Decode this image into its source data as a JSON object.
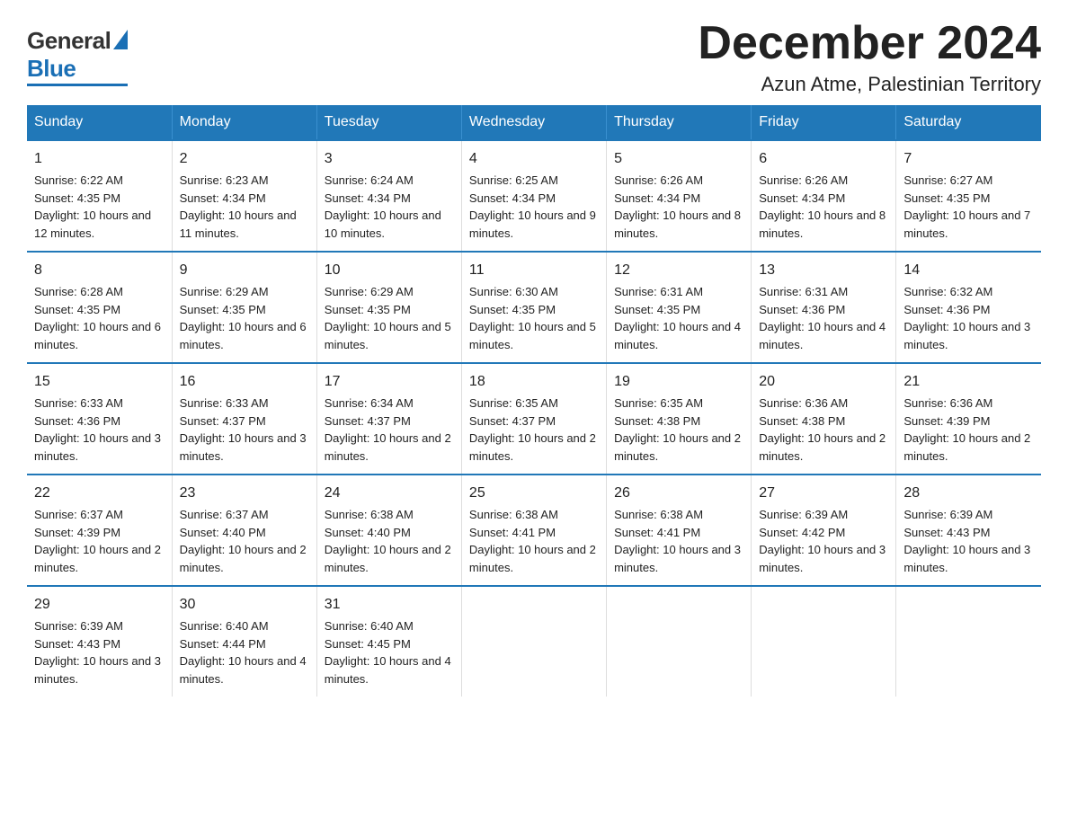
{
  "logo": {
    "general": "General",
    "blue": "Blue"
  },
  "title": "December 2024",
  "subtitle": "Azun Atme, Palestinian Territory",
  "days_of_week": [
    "Sunday",
    "Monday",
    "Tuesday",
    "Wednesday",
    "Thursday",
    "Friday",
    "Saturday"
  ],
  "weeks": [
    [
      {
        "day": "1",
        "sunrise": "Sunrise: 6:22 AM",
        "sunset": "Sunset: 4:35 PM",
        "daylight": "Daylight: 10 hours and 12 minutes."
      },
      {
        "day": "2",
        "sunrise": "Sunrise: 6:23 AM",
        "sunset": "Sunset: 4:34 PM",
        "daylight": "Daylight: 10 hours and 11 minutes."
      },
      {
        "day": "3",
        "sunrise": "Sunrise: 6:24 AM",
        "sunset": "Sunset: 4:34 PM",
        "daylight": "Daylight: 10 hours and 10 minutes."
      },
      {
        "day": "4",
        "sunrise": "Sunrise: 6:25 AM",
        "sunset": "Sunset: 4:34 PM",
        "daylight": "Daylight: 10 hours and 9 minutes."
      },
      {
        "day": "5",
        "sunrise": "Sunrise: 6:26 AM",
        "sunset": "Sunset: 4:34 PM",
        "daylight": "Daylight: 10 hours and 8 minutes."
      },
      {
        "day": "6",
        "sunrise": "Sunrise: 6:26 AM",
        "sunset": "Sunset: 4:34 PM",
        "daylight": "Daylight: 10 hours and 8 minutes."
      },
      {
        "day": "7",
        "sunrise": "Sunrise: 6:27 AM",
        "sunset": "Sunset: 4:35 PM",
        "daylight": "Daylight: 10 hours and 7 minutes."
      }
    ],
    [
      {
        "day": "8",
        "sunrise": "Sunrise: 6:28 AM",
        "sunset": "Sunset: 4:35 PM",
        "daylight": "Daylight: 10 hours and 6 minutes."
      },
      {
        "day": "9",
        "sunrise": "Sunrise: 6:29 AM",
        "sunset": "Sunset: 4:35 PM",
        "daylight": "Daylight: 10 hours and 6 minutes."
      },
      {
        "day": "10",
        "sunrise": "Sunrise: 6:29 AM",
        "sunset": "Sunset: 4:35 PM",
        "daylight": "Daylight: 10 hours and 5 minutes."
      },
      {
        "day": "11",
        "sunrise": "Sunrise: 6:30 AM",
        "sunset": "Sunset: 4:35 PM",
        "daylight": "Daylight: 10 hours and 5 minutes."
      },
      {
        "day": "12",
        "sunrise": "Sunrise: 6:31 AM",
        "sunset": "Sunset: 4:35 PM",
        "daylight": "Daylight: 10 hours and 4 minutes."
      },
      {
        "day": "13",
        "sunrise": "Sunrise: 6:31 AM",
        "sunset": "Sunset: 4:36 PM",
        "daylight": "Daylight: 10 hours and 4 minutes."
      },
      {
        "day": "14",
        "sunrise": "Sunrise: 6:32 AM",
        "sunset": "Sunset: 4:36 PM",
        "daylight": "Daylight: 10 hours and 3 minutes."
      }
    ],
    [
      {
        "day": "15",
        "sunrise": "Sunrise: 6:33 AM",
        "sunset": "Sunset: 4:36 PM",
        "daylight": "Daylight: 10 hours and 3 minutes."
      },
      {
        "day": "16",
        "sunrise": "Sunrise: 6:33 AM",
        "sunset": "Sunset: 4:37 PM",
        "daylight": "Daylight: 10 hours and 3 minutes."
      },
      {
        "day": "17",
        "sunrise": "Sunrise: 6:34 AM",
        "sunset": "Sunset: 4:37 PM",
        "daylight": "Daylight: 10 hours and 2 minutes."
      },
      {
        "day": "18",
        "sunrise": "Sunrise: 6:35 AM",
        "sunset": "Sunset: 4:37 PM",
        "daylight": "Daylight: 10 hours and 2 minutes."
      },
      {
        "day": "19",
        "sunrise": "Sunrise: 6:35 AM",
        "sunset": "Sunset: 4:38 PM",
        "daylight": "Daylight: 10 hours and 2 minutes."
      },
      {
        "day": "20",
        "sunrise": "Sunrise: 6:36 AM",
        "sunset": "Sunset: 4:38 PM",
        "daylight": "Daylight: 10 hours and 2 minutes."
      },
      {
        "day": "21",
        "sunrise": "Sunrise: 6:36 AM",
        "sunset": "Sunset: 4:39 PM",
        "daylight": "Daylight: 10 hours and 2 minutes."
      }
    ],
    [
      {
        "day": "22",
        "sunrise": "Sunrise: 6:37 AM",
        "sunset": "Sunset: 4:39 PM",
        "daylight": "Daylight: 10 hours and 2 minutes."
      },
      {
        "day": "23",
        "sunrise": "Sunrise: 6:37 AM",
        "sunset": "Sunset: 4:40 PM",
        "daylight": "Daylight: 10 hours and 2 minutes."
      },
      {
        "day": "24",
        "sunrise": "Sunrise: 6:38 AM",
        "sunset": "Sunset: 4:40 PM",
        "daylight": "Daylight: 10 hours and 2 minutes."
      },
      {
        "day": "25",
        "sunrise": "Sunrise: 6:38 AM",
        "sunset": "Sunset: 4:41 PM",
        "daylight": "Daylight: 10 hours and 2 minutes."
      },
      {
        "day": "26",
        "sunrise": "Sunrise: 6:38 AM",
        "sunset": "Sunset: 4:41 PM",
        "daylight": "Daylight: 10 hours and 3 minutes."
      },
      {
        "day": "27",
        "sunrise": "Sunrise: 6:39 AM",
        "sunset": "Sunset: 4:42 PM",
        "daylight": "Daylight: 10 hours and 3 minutes."
      },
      {
        "day": "28",
        "sunrise": "Sunrise: 6:39 AM",
        "sunset": "Sunset: 4:43 PM",
        "daylight": "Daylight: 10 hours and 3 minutes."
      }
    ],
    [
      {
        "day": "29",
        "sunrise": "Sunrise: 6:39 AM",
        "sunset": "Sunset: 4:43 PM",
        "daylight": "Daylight: 10 hours and 3 minutes."
      },
      {
        "day": "30",
        "sunrise": "Sunrise: 6:40 AM",
        "sunset": "Sunset: 4:44 PM",
        "daylight": "Daylight: 10 hours and 4 minutes."
      },
      {
        "day": "31",
        "sunrise": "Sunrise: 6:40 AM",
        "sunset": "Sunset: 4:45 PM",
        "daylight": "Daylight: 10 hours and 4 minutes."
      },
      {
        "day": "",
        "sunrise": "",
        "sunset": "",
        "daylight": ""
      },
      {
        "day": "",
        "sunrise": "",
        "sunset": "",
        "daylight": ""
      },
      {
        "day": "",
        "sunrise": "",
        "sunset": "",
        "daylight": ""
      },
      {
        "day": "",
        "sunrise": "",
        "sunset": "",
        "daylight": ""
      }
    ]
  ]
}
